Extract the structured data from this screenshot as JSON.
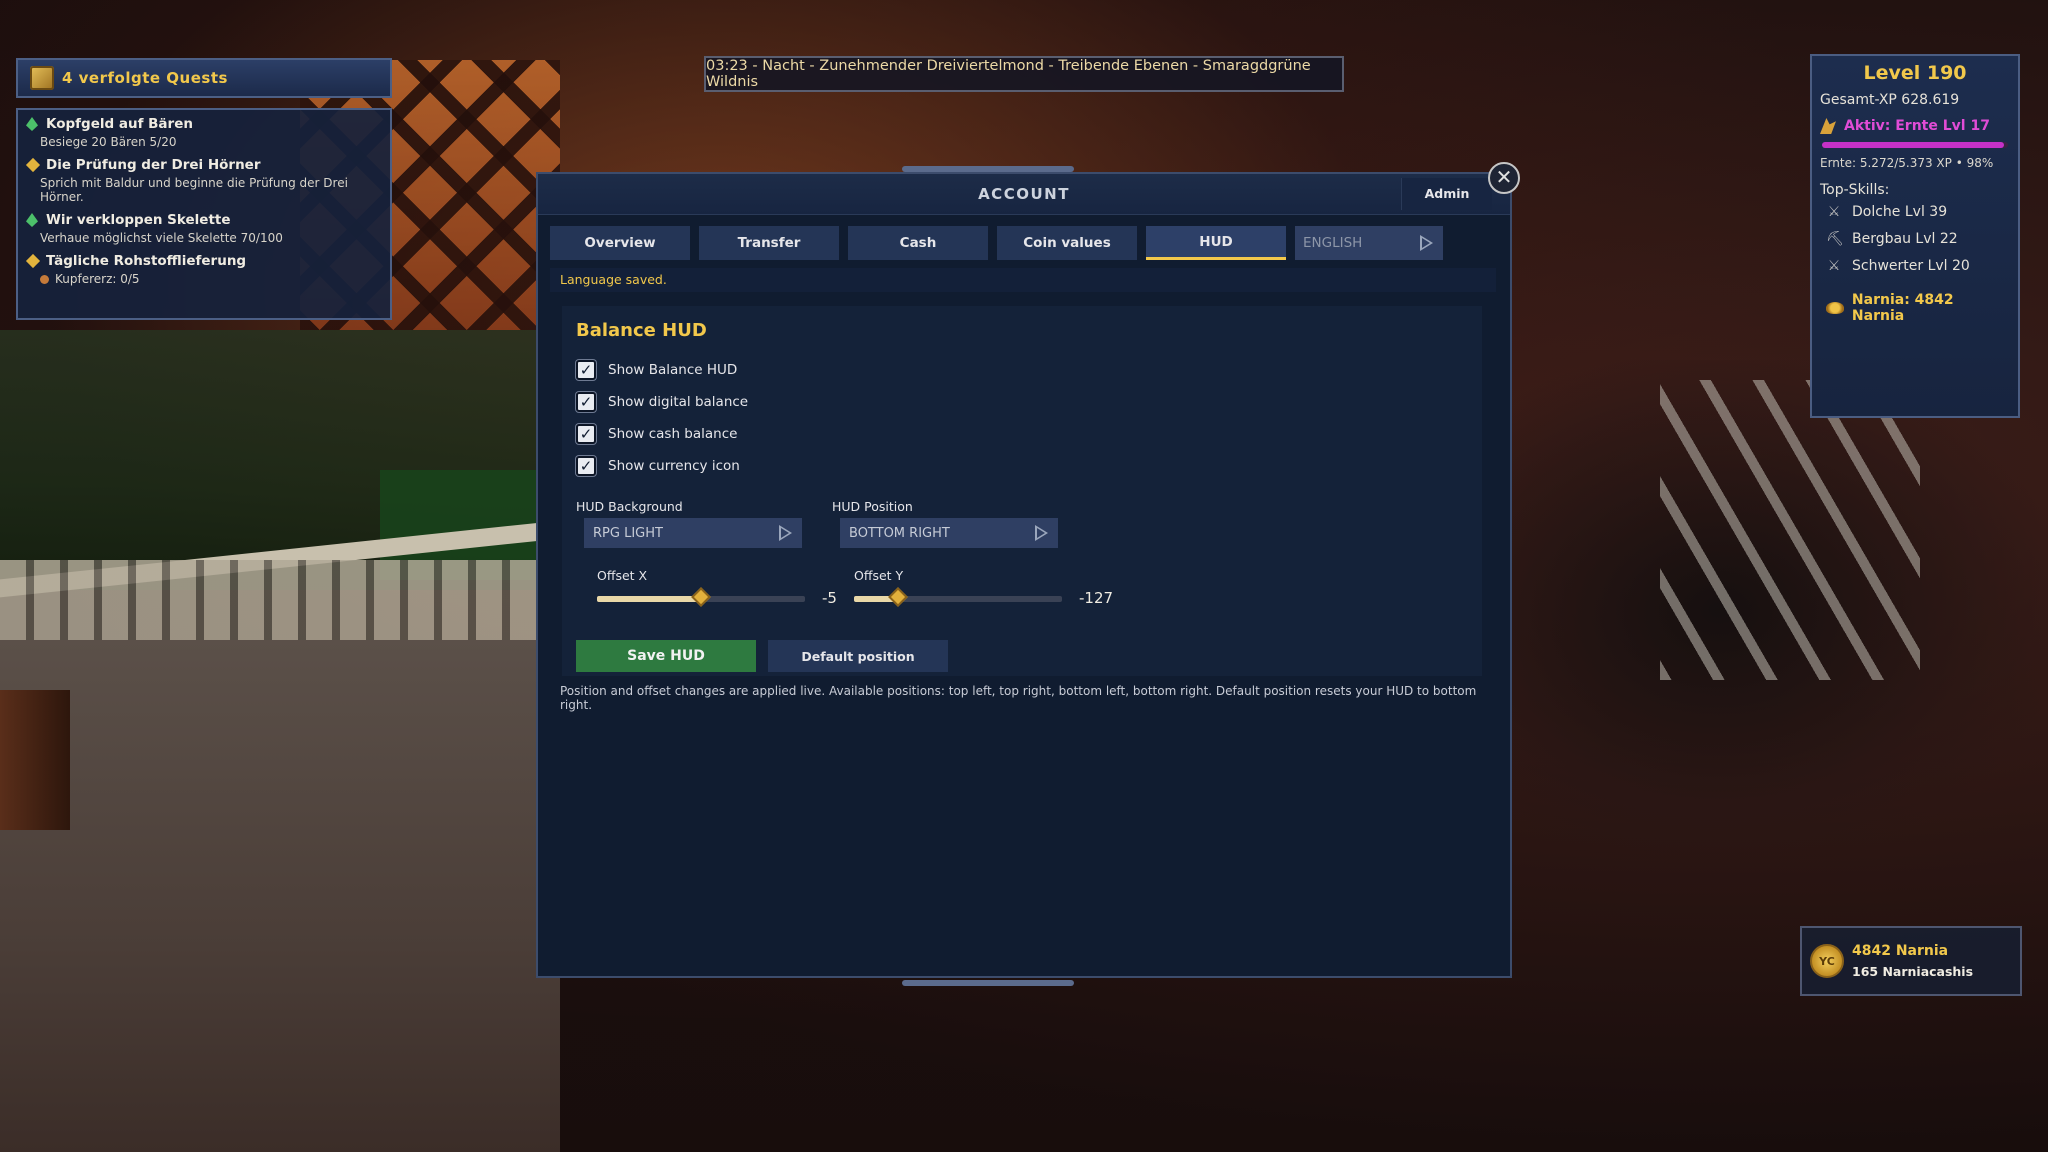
{
  "quests": {
    "header": "4 verfolgte Quests",
    "items": [
      {
        "title": "Kopfgeld auf Bären",
        "sub": "Besiege 20 Bären 5/20",
        "icon": "green-crystal-icon"
      },
      {
        "title": "Die Prüfung der Drei Hörner",
        "sub": "Sprich mit Baldur und beginne die Prüfung der Drei Hörner.",
        "icon": "gold-quest-icon"
      },
      {
        "title": "Wir verkloppen Skelette",
        "sub": "Verhaue möglichst viele Skelette 70/100",
        "icon": "green-crystal-icon"
      },
      {
        "title": "Tägliche Rohstofflieferung",
        "sub": "Kupfererz: 0/5",
        "icon": "gold-quest-icon"
      }
    ]
  },
  "infobar": {
    "text": "03:23 - Nacht - Zunehmender Dreiviertelmond - Treibende Ebenen - Smaragdgrüne Wildnis"
  },
  "level": {
    "title": "Level 190",
    "total_xp": "Gesamt-XP 628.619",
    "active": "Aktiv: Ernte Lvl 17",
    "xp_fraction": 0.98,
    "xp_detail": "Ernte: 5.272/5.373 XP • 98%",
    "top_skills_label": "Top-Skills:",
    "skills": [
      {
        "label": "Dolche Lvl 39",
        "icon": "dagger-icon"
      },
      {
        "label": "Bergbau Lvl 22",
        "icon": "pickaxe-icon"
      },
      {
        "label": "Schwerter Lvl 20",
        "icon": "sword-icon"
      }
    ],
    "narnia": "Narnia: 4842 Narnia"
  },
  "balance_hud": {
    "coin_label": "YC",
    "line1": "4842 Narnia",
    "line2": "165 Narniacashis"
  },
  "modal": {
    "title": "ACCOUNT",
    "admin": "Admin",
    "close": "✕",
    "tabs": [
      {
        "label": "Overview",
        "active": false
      },
      {
        "label": "Transfer",
        "active": false
      },
      {
        "label": "Cash",
        "active": false
      },
      {
        "label": "Coin values",
        "active": false
      },
      {
        "label": "HUD",
        "active": true
      }
    ],
    "language": "ENGLISH",
    "status": "Language saved.",
    "section_title": "Balance HUD",
    "checkboxes": [
      {
        "label": "Show Balance HUD",
        "checked": true
      },
      {
        "label": "Show digital balance",
        "checked": true
      },
      {
        "label": "Show cash balance",
        "checked": true
      },
      {
        "label": "Show currency icon",
        "checked": true
      }
    ],
    "hud_background": {
      "label": "HUD Background",
      "value": "RPG LIGHT"
    },
    "hud_position": {
      "label": "HUD Position",
      "value": "BOTTOM RIGHT"
    },
    "offset_x": {
      "label": "Offset X",
      "value": "-5",
      "fraction": 0.5
    },
    "offset_y": {
      "label": "Offset Y",
      "value": "-127",
      "fraction": 0.21
    },
    "save_button": "Save HUD",
    "default_button": "Default position",
    "help": "Position and offset changes are applied live. Available positions: top left, top right, bottom left, bottom right. Default position resets your HUD to bottom right."
  },
  "colors": {
    "accent_gold": "#f2c84b",
    "active_skill": "#e14cd6",
    "save_green": "#2e7a40",
    "panel_bg": "#101c30"
  }
}
